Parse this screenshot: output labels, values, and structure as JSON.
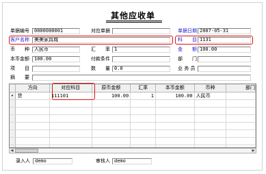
{
  "form": {
    "title": "其他应收单",
    "header": {
      "doc_no_label": "单据编号",
      "doc_no": "0000000001",
      "ref_doc_label": "对应单据",
      "ref_doc": "",
      "date_label": "单据日期",
      "date": "2007-05-31",
      "customer_label": "客户名称",
      "customer": "美美家具城",
      "subject_label": "科　　目",
      "subject": "1131",
      "currency_label": "币　　种",
      "currency": "人民币",
      "rate_label": "汇　　率",
      "rate": "1",
      "amount_label": "金　　额",
      "amount": "100.00",
      "local_amount_label": "本币金额",
      "local_amount": "100.00",
      "payment_terms_label": "付款条件",
      "payment_terms": "",
      "department_label": "部　　门",
      "department": "",
      "item_label": "项　　目",
      "item": "",
      "quantity_label": "数　　量",
      "quantity": "0.0",
      "salesperson_label": "业 务 员",
      "salesperson": "",
      "summary_label": "摘　　要",
      "summary": ""
    },
    "grid": {
      "columns": [
        "方向",
        "对应科目",
        "原币金额",
        "汇率",
        "本币金额",
        "币种",
        "部门"
      ],
      "rows": [
        {
          "indicator": "▸",
          "direction": "贷",
          "subject": "111101",
          "orig_amount": "100.00",
          "rate": "1",
          "local_amount": "100.00",
          "currency": "人民币",
          "dept": ""
        }
      ]
    },
    "footer": {
      "entered_by_label": "录入人",
      "entered_by": "demo",
      "reviewer_label": "审核人",
      "reviewer": "demo"
    },
    "colors": {
      "highlight_red": "#e01010",
      "label_blue": "#2020d0"
    }
  }
}
